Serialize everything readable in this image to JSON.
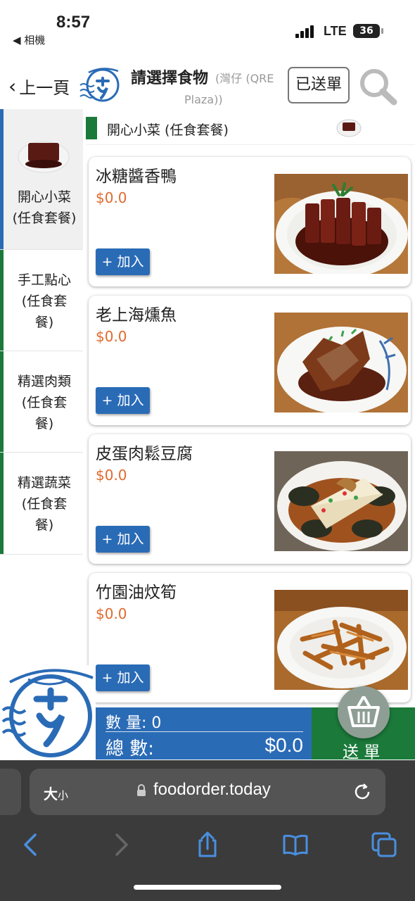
{
  "status_bar": {
    "time": "8:57",
    "back_app": "◀ 相機",
    "network": "LTE",
    "battery": "36"
  },
  "header": {
    "back_label": "上一頁",
    "title": "請選擇食物",
    "branch_line1": "(灣仔 (QRE",
    "branch_line2": "Plaza))",
    "sent_button": "已送單"
  },
  "sidebar": {
    "items": [
      {
        "label_lines": [
          "開心小菜",
          "(任食套餐)"
        ],
        "active": true
      },
      {
        "label_lines": [
          "手工點心",
          "(任食套",
          "餐)"
        ],
        "active": false
      },
      {
        "label_lines": [
          "精選肉類",
          "(任食套",
          "餐)"
        ],
        "active": false
      },
      {
        "label_lines": [
          "精選蔬菜",
          "(任食套",
          "餐)"
        ],
        "active": false
      }
    ]
  },
  "section": {
    "title": "開心小菜 (任食套餐)"
  },
  "items": [
    {
      "name": "冰糖醬香鴨",
      "price": "$0.0",
      "add_label": "+ 加入",
      "photo": "braised-duck"
    },
    {
      "name": "老上海燻魚",
      "price": "$0.0",
      "add_label": "+ 加入",
      "photo": "smoked-fish"
    },
    {
      "name": "皮蛋肉鬆豆腐",
      "price": "$0.0",
      "add_label": "+ 加入",
      "photo": "century-egg-tofu"
    },
    {
      "name": "竹園油炆筍",
      "price": "$0.0",
      "add_label": "+ 加入",
      "photo": "braised-bamboo-shoots"
    }
  ],
  "summary": {
    "qty_label": "數 量:",
    "qty_value": "0",
    "total_label": "總 數:",
    "total_value": "$0.0",
    "send_label": "送 單"
  },
  "browser": {
    "text_size_big": "大",
    "text_size_small": "小",
    "url": "foodorder.today"
  },
  "colors": {
    "brand_blue": "#2a6bb6",
    "brand_green": "#1b7a3a",
    "price_orange": "#e06a2e"
  }
}
